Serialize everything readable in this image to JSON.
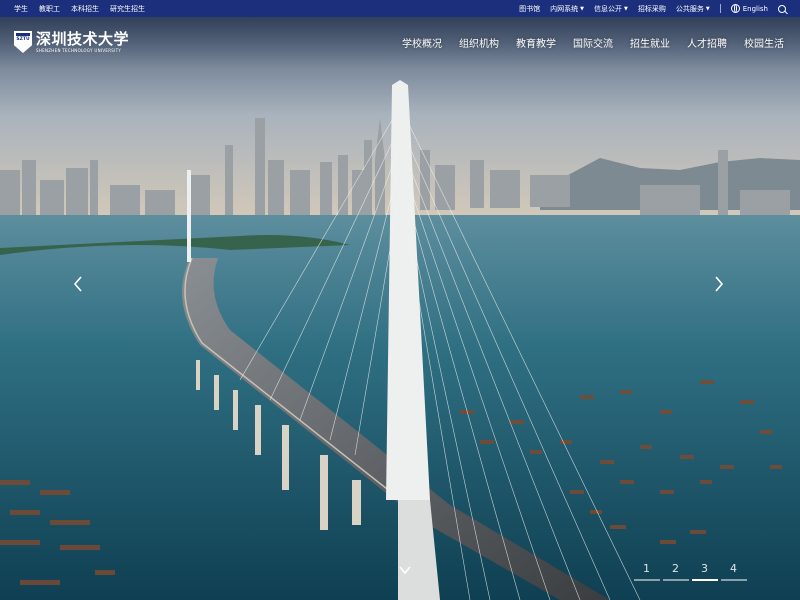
{
  "topbar": {
    "left_links": [
      "学生",
      "教职工",
      "本科招生",
      "研究生招生"
    ],
    "right_links": [
      {
        "label": "图书馆",
        "dropdown": false
      },
      {
        "label": "内网系统",
        "dropdown": true
      },
      {
        "label": "信息公开",
        "dropdown": true
      },
      {
        "label": "招标采购",
        "dropdown": false
      },
      {
        "label": "公共服务",
        "dropdown": true
      }
    ],
    "language": "English",
    "icons": {
      "language": "globe-icon",
      "search": "search-icon"
    }
  },
  "header": {
    "logo": {
      "shield_text": "SZTU",
      "name_cn": "深圳技术大学",
      "name_en": "SHENZHEN TECHNOLOGY UNIVERSITY"
    },
    "nav": [
      "学校概况",
      "组织机构",
      "教育教学",
      "国际交流",
      "招生就业",
      "人才招聘",
      "校园生活"
    ]
  },
  "carousel": {
    "prev_icon": "chevron-left-icon",
    "next_icon": "chevron-right-icon",
    "scroll_icon": "chevron-down-icon",
    "pages": [
      "1",
      "2",
      "3",
      "4"
    ],
    "active_page": 3
  },
  "colors": {
    "topbar_bg": "#1b2f7d",
    "text": "#ffffff"
  }
}
